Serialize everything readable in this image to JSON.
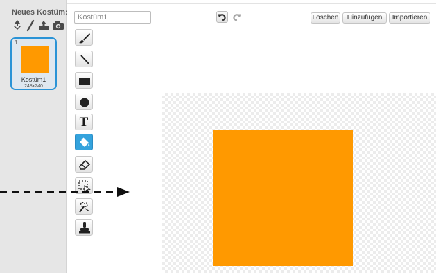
{
  "costume_panel": {
    "title": "Neues Kostüm:",
    "new_icons": [
      "paint-from-library-icon",
      "paint-new-icon",
      "upload-icon",
      "camera-icon"
    ],
    "costumes": [
      {
        "number": "1",
        "name": "Kostüm1",
        "size": "248x240",
        "color": "#ff9900",
        "selected": true
      }
    ]
  },
  "toolbar": {
    "costume_name_value": "Kostüm1",
    "undo_icon": "undo-icon",
    "redo_icon": "redo-icon",
    "delete_label": "Löschen",
    "add_label": "Hinzufügen",
    "import_label": "Importieren"
  },
  "tools": [
    {
      "name": "brush-tool",
      "icon": "brush-icon"
    },
    {
      "name": "line-tool",
      "icon": "line-icon"
    },
    {
      "name": "rectangle-tool",
      "icon": "rectangle-icon"
    },
    {
      "name": "ellipse-tool",
      "icon": "ellipse-icon"
    },
    {
      "name": "text-tool",
      "icon": "text-icon",
      "glyph": "T"
    },
    {
      "name": "fill-tool",
      "icon": "paint-bucket-icon",
      "active": true
    },
    {
      "name": "eraser-tool",
      "icon": "eraser-icon"
    },
    {
      "name": "select-tool",
      "icon": "select-icon"
    },
    {
      "name": "magic-select-tool",
      "icon": "magic-wand-icon"
    },
    {
      "name": "stamp-tool",
      "icon": "stamp-icon"
    }
  ],
  "canvas": {
    "shape": "orange-square",
    "fill_color": "#ff9900"
  },
  "colors": {
    "accent": "#34a3dd",
    "selection_border": "#2a93d6",
    "panel_bg": "#e6e6e6"
  }
}
